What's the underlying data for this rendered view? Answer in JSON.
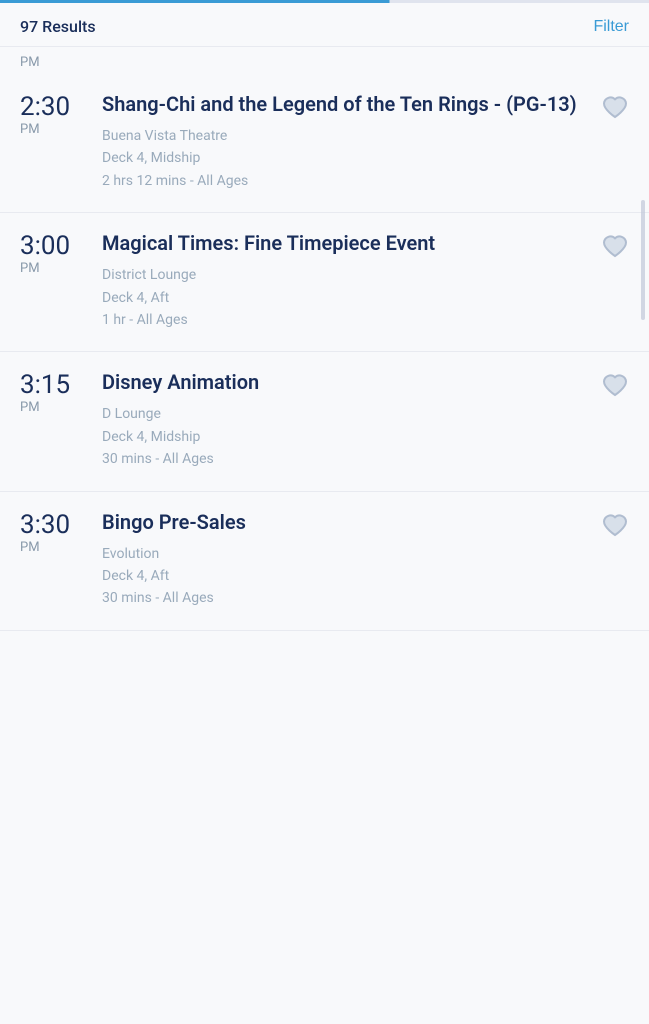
{
  "header": {
    "results_count": "97 Results",
    "filter_label": "Filter"
  },
  "time_label": "PM",
  "events": [
    {
      "id": "event-1",
      "time_hour": "2:30",
      "time_ampm": "PM",
      "title": "Shang-Chi and the Legend of the Ten Rings - (PG-13)",
      "venue": "Buena Vista Theatre",
      "location": "Deck 4, Midship",
      "duration": "2 hrs 12 mins - All Ages"
    },
    {
      "id": "event-2",
      "time_hour": "3:00",
      "time_ampm": "PM",
      "title": "Magical Times: Fine Timepiece Event",
      "venue": "District Lounge",
      "location": "Deck 4, Aft",
      "duration": "1 hr - All Ages"
    },
    {
      "id": "event-3",
      "time_hour": "3:15",
      "time_ampm": "PM",
      "title": "Disney Animation",
      "venue": "D Lounge",
      "location": "Deck 4, Midship",
      "duration": "30 mins - All Ages"
    },
    {
      "id": "event-4",
      "time_hour": "3:30",
      "time_ampm": "PM",
      "title": "Bingo Pre-Sales",
      "venue": "Evolution",
      "location": "Deck 4, Aft",
      "duration": "30 mins - All Ages"
    }
  ]
}
